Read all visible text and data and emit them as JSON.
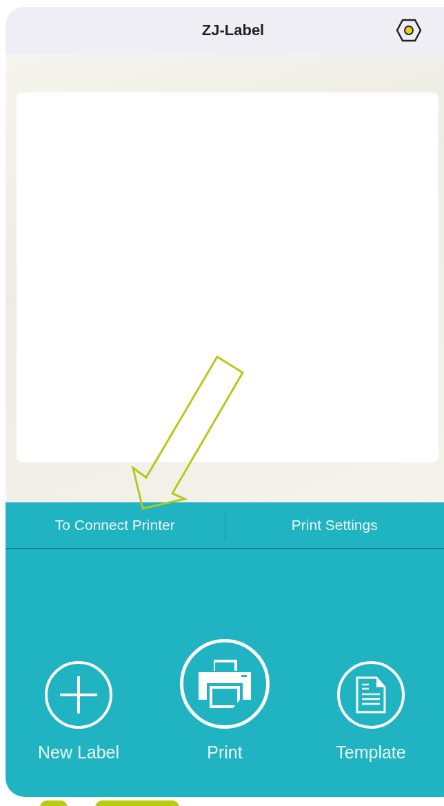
{
  "header": {
    "title": "ZJ-Label"
  },
  "tabs": [
    {
      "label": "To Connect Printer"
    },
    {
      "label": "Print Settings"
    }
  ],
  "actions": [
    {
      "kind": "plus",
      "label": "New Label"
    },
    {
      "kind": "printer",
      "label": "Print"
    },
    {
      "kind": "document",
      "label": "Template"
    }
  ]
}
